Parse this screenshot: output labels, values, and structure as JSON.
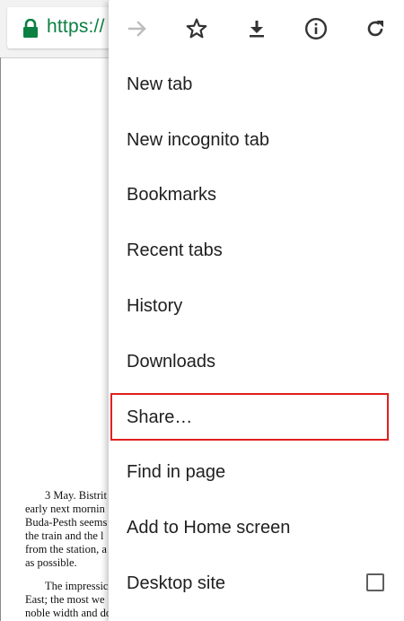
{
  "toolbar": {
    "url_text": "https://",
    "url_color": "#0b8043",
    "lock_icon": "lock-icon"
  },
  "document": {
    "lines": [
      "3 May. Bistrit",
      "early next mornin",
      "Buda-Pesth seems",
      "the train and the l",
      "from the station, a",
      "as possible.",
      "The impressic",
      "East; the most we",
      "noble width and do"
    ]
  },
  "menu": {
    "icons": [
      {
        "name": "forward-icon",
        "enabled": false
      },
      {
        "name": "bookmark-star-icon",
        "enabled": true
      },
      {
        "name": "download-icon",
        "enabled": true
      },
      {
        "name": "info-icon",
        "enabled": true
      },
      {
        "name": "refresh-icon",
        "enabled": true
      }
    ],
    "items": [
      {
        "label": "New tab"
      },
      {
        "label": "New incognito tab"
      },
      {
        "label": "Bookmarks"
      },
      {
        "label": "Recent tabs"
      },
      {
        "label": "History"
      },
      {
        "label": "Downloads"
      },
      {
        "label": "Share…",
        "highlighted": true
      },
      {
        "label": "Find in page"
      },
      {
        "label": "Add to Home screen"
      },
      {
        "label": "Desktop site",
        "checkbox": false
      }
    ],
    "highlight_color": "#e02020"
  }
}
